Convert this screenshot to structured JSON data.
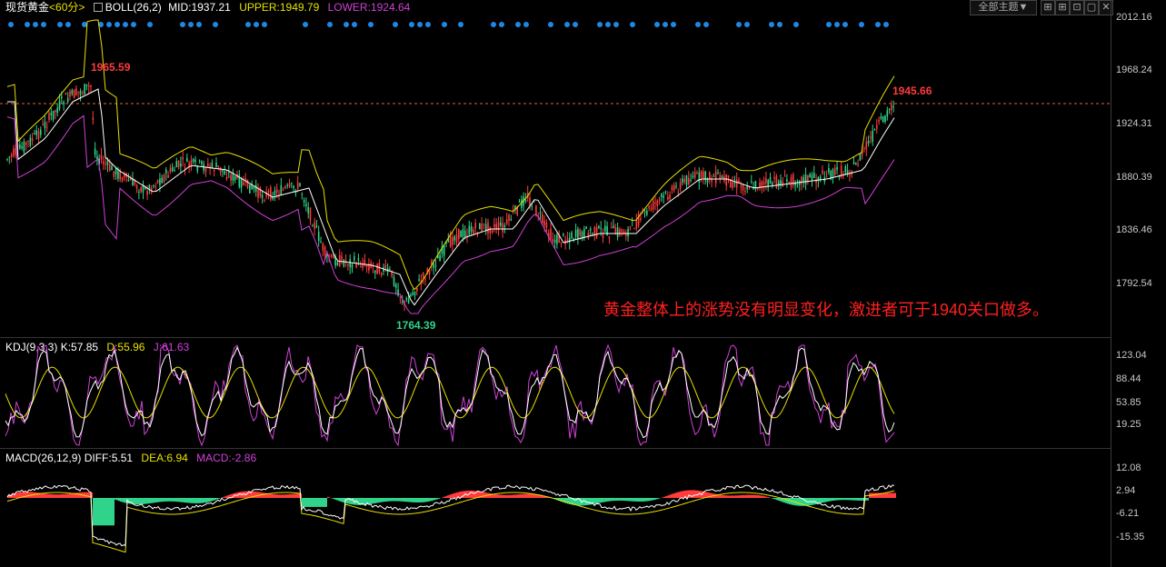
{
  "main": {
    "symbol": "现货黄金",
    "period": "<60分>",
    "boll_label": "BOLL(26,2)",
    "mid": "MID:1937.21",
    "upper": "UPPER:1949.79",
    "lower": "LOWER:1924.64",
    "y_ticks": [
      "2012.16",
      "1968.24",
      "1924.31",
      "1880.39",
      "1836.46",
      "1792.54"
    ],
    "high_label": "1965.59",
    "low_label": "1764.39",
    "last_label": "1945.66",
    "annotation": "黄金整体上的涨势没有明显变化，激进者可于1940关口做多。"
  },
  "toolbar": {
    "theme_select": "全部主题▼",
    "icons": [
      "grid-icon",
      "grid2-icon",
      "settings-icon",
      "close-icon"
    ]
  },
  "kdj": {
    "label": "KDJ(9,3,3)",
    "k": "K:57.85",
    "d": "D:55.96",
    "j": "J:61.63",
    "y_ticks": [
      "123.04",
      "88.44",
      "53.85",
      "19.25"
    ]
  },
  "macd": {
    "label": "MACD(26,12,9)",
    "diff": "DIFF:5.51",
    "dea": "DEA:6.94",
    "macd": "MACD:-2.86",
    "y_ticks": [
      "12.08",
      "2.94",
      "-6.21",
      "-15.35"
    ]
  },
  "colors": {
    "up": "#ff3b3b",
    "down": "#2fd48a",
    "boll_mid": "#ffffff",
    "boll_upper": "#e8e000",
    "boll_lower": "#d040d8",
    "annotation": "#ff2020",
    "dots": "#1e88e5"
  }
}
